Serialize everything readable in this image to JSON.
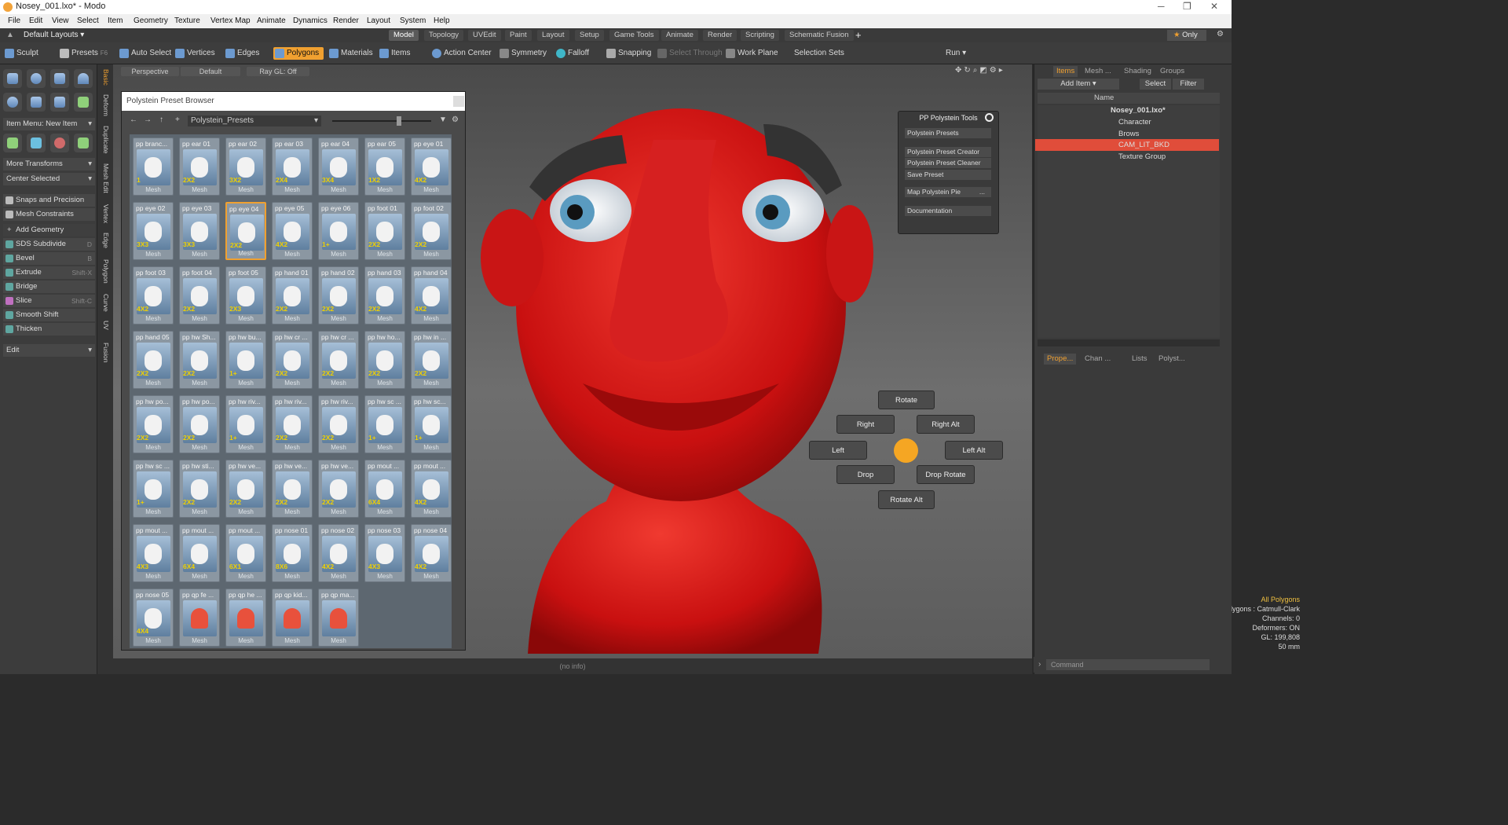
{
  "window": {
    "title": "Nosey_001.lxo* - Modo"
  },
  "menu": [
    "File",
    "Edit",
    "View",
    "Select",
    "Item",
    "Geometry",
    "Texture",
    "Vertex Map",
    "Animate",
    "Dynamics",
    "Render",
    "Layout",
    "System",
    "Help"
  ],
  "layout": {
    "default": "Default Layouts",
    "tabs": [
      "Model",
      "Topology",
      "UVEdit",
      "Paint",
      "Layout",
      "Setup",
      "Game Tools",
      "Animate",
      "Render",
      "Scripting",
      "Schematic Fusion"
    ],
    "active": "Model",
    "only": "Only"
  },
  "toolbar": {
    "sculpt": "Sculpt",
    "presets": "Presets",
    "presets_key": "F6",
    "auto_select": "Auto Select",
    "vertices": "Vertices",
    "edges": "Edges",
    "polygons": "Polygons",
    "materials": "Materials",
    "items": "Items",
    "action_center": "Action Center",
    "symmetry": "Symmetry",
    "falloff": "Falloff",
    "snapping": "Snapping",
    "select_through": "Select Through",
    "work_plane": "Work Plane",
    "selection_sets": "Selection Sets",
    "run": "Run"
  },
  "left": {
    "item_menu": "Item Menu: New Item",
    "more_transforms": "More Transforms",
    "center_selected": "Center Selected",
    "snaps": "Snaps and Precision",
    "constraints": "Mesh Constraints",
    "add_geometry": "Add Geometry",
    "tools": [
      {
        "label": "SDS Subdivide",
        "key": "D"
      },
      {
        "label": "Bevel",
        "key": "B"
      },
      {
        "label": "Extrude",
        "key": "Shift-X"
      },
      {
        "label": "Bridge",
        "key": ""
      },
      {
        "label": "Slice",
        "key": "Shift-C"
      },
      {
        "label": "Smooth Shift",
        "key": ""
      },
      {
        "label": "Thicken",
        "key": ""
      }
    ],
    "edit": "Edit"
  },
  "vtabs": [
    "Basic",
    "Deform",
    "Duplicate",
    "Mesh Edit",
    "Vertex",
    "Edge",
    "Polygon",
    "Curve",
    "UV",
    "Fusion"
  ],
  "viewport": {
    "perspective": "Perspective",
    "default": "Default",
    "raygl": "Ray GL: Off",
    "no_info": "(no info)"
  },
  "browser": {
    "title": "Polystein Preset Browser",
    "folder": "Polystein_Presets",
    "items": [
      {
        "n": "pp branc...",
        "b": "1",
        "m": "Mesh"
      },
      {
        "n": "pp ear 01",
        "b": "2X2",
        "m": "Mesh"
      },
      {
        "n": "pp ear 02",
        "b": "3X2",
        "m": "Mesh"
      },
      {
        "n": "pp ear 03",
        "b": "2X4",
        "m": "Mesh"
      },
      {
        "n": "pp ear 04",
        "b": "3X4",
        "m": "Mesh"
      },
      {
        "n": "pp ear 05",
        "b": "1X2",
        "m": "Mesh"
      },
      {
        "n": "pp eye 01",
        "b": "4X2",
        "m": "Mesh"
      },
      {
        "n": "pp eye 02",
        "b": "3X3",
        "m": "Mesh"
      },
      {
        "n": "pp eye 03",
        "b": "3X3",
        "m": "Mesh"
      },
      {
        "n": "pp eye 04",
        "b": "2X2",
        "m": "Mesh"
      },
      {
        "n": "pp eye 05",
        "b": "4X2",
        "m": "Mesh"
      },
      {
        "n": "pp eye 06",
        "b": "1+",
        "m": "Mesh"
      },
      {
        "n": "pp foot 01",
        "b": "2X2",
        "m": "Mesh"
      },
      {
        "n": "pp foot 02",
        "b": "2X2",
        "m": "Mesh"
      },
      {
        "n": "pp foot 03",
        "b": "4X2",
        "m": "Mesh"
      },
      {
        "n": "pp foot 04",
        "b": "2X2",
        "m": "Mesh"
      },
      {
        "n": "pp foot 05",
        "b": "2X3",
        "m": "Mesh"
      },
      {
        "n": "pp hand 01",
        "b": "2X2",
        "m": "Mesh"
      },
      {
        "n": "pp hand 02",
        "b": "2X2",
        "m": "Mesh"
      },
      {
        "n": "pp hand 03",
        "b": "2X2",
        "m": "Mesh"
      },
      {
        "n": "pp hand 04",
        "b": "4X2",
        "m": "Mesh"
      },
      {
        "n": "pp hand 05",
        "b": "2X2",
        "m": "Mesh"
      },
      {
        "n": "pp hw Sh...",
        "b": "2X2",
        "m": "Mesh"
      },
      {
        "n": "pp hw bu...",
        "b": "1+",
        "m": "Mesh"
      },
      {
        "n": "pp hw cr ...",
        "b": "2X2",
        "m": "Mesh"
      },
      {
        "n": "pp hw cr ...",
        "b": "2X2",
        "m": "Mesh"
      },
      {
        "n": "pp hw ho...",
        "b": "2X2",
        "m": "Mesh"
      },
      {
        "n": "pp hw in ...",
        "b": "2X2",
        "m": "Mesh"
      },
      {
        "n": "pp hw po...",
        "b": "2X2",
        "m": "Mesh"
      },
      {
        "n": "pp hw po...",
        "b": "2X2",
        "m": "Mesh"
      },
      {
        "n": "pp hw riv...",
        "b": "1+",
        "m": "Mesh"
      },
      {
        "n": "pp hw riv...",
        "b": "2X2",
        "m": "Mesh"
      },
      {
        "n": "pp hw riv...",
        "b": "2X2",
        "m": "Mesh"
      },
      {
        "n": "pp hw sc ...",
        "b": "1+",
        "m": "Mesh"
      },
      {
        "n": "pp hw sc...",
        "b": "1+",
        "m": "Mesh"
      },
      {
        "n": "pp hw sc ...",
        "b": "1+",
        "m": "Mesh"
      },
      {
        "n": "pp hw sti...",
        "b": "2X2",
        "m": "Mesh"
      },
      {
        "n": "pp hw ve...",
        "b": "2X2",
        "m": "Mesh"
      },
      {
        "n": "pp hw ve...",
        "b": "2X2",
        "m": "Mesh"
      },
      {
        "n": "pp hw ve...",
        "b": "2X2",
        "m": "Mesh"
      },
      {
        "n": "pp mout ...",
        "b": "6X4",
        "m": "Mesh"
      },
      {
        "n": "pp mout ...",
        "b": "4X2",
        "m": "Mesh"
      },
      {
        "n": "pp mout ...",
        "b": "4X3",
        "m": "Mesh"
      },
      {
        "n": "pp mout ...",
        "b": "6X4",
        "m": "Mesh"
      },
      {
        "n": "pp mout ...",
        "b": "6X1",
        "m": "Mesh"
      },
      {
        "n": "pp nose 01",
        "b": "8X6",
        "m": "Mesh"
      },
      {
        "n": "pp nose 02",
        "b": "4X2",
        "m": "Mesh"
      },
      {
        "n": "pp nose 03",
        "b": "4X3",
        "m": "Mesh"
      },
      {
        "n": "pp nose 04",
        "b": "4X2",
        "m": "Mesh"
      },
      {
        "n": "pp nose 05",
        "b": "4X4",
        "m": "Mesh"
      },
      {
        "n": "pp qp fe ...",
        "b": "",
        "m": "Mesh"
      },
      {
        "n": "pp qp he ...",
        "b": "",
        "m": "Mesh"
      },
      {
        "n": "pp qp kid...",
        "b": "",
        "m": "Mesh"
      },
      {
        "n": "pp qp ma...",
        "b": "",
        "m": "Mesh"
      }
    ]
  },
  "pp_tools": {
    "title": "PP Polystein Tools",
    "buttons": [
      "Polystein Presets",
      "Polystein Preset Creator",
      "Polystein Preset Cleaner",
      "Save Preset",
      "Map Polystein Pie",
      "Documentation"
    ],
    "dots": "..."
  },
  "pie": {
    "rotate": "Rotate",
    "right": "Right",
    "right_alt": "Right Alt",
    "left": "Left",
    "left_alt": "Left Alt",
    "drop": "Drop",
    "drop_rotate": "Drop Rotate",
    "rotate_alt": "Rotate Alt"
  },
  "hud": {
    "line1": "All Polygons",
    "line2": "Polygons : Catmull-Clark",
    "line3": "Channels: 0",
    "line4": "Deformers: ON",
    "line5": "GL: 199,808",
    "line6": "50 mm"
  },
  "right": {
    "tabs": [
      "Items",
      "Mesh ...",
      "Shading",
      "Groups"
    ],
    "add_item": "Add Item",
    "select": "Select",
    "filter": "Filter",
    "name_col": "Name",
    "tree": [
      "Nosey_001.lxo*",
      "Character",
      "Brows",
      "CAM_LIT_BKD",
      "Texture Group"
    ],
    "props_tabs": [
      "Prope...",
      "Chan ...",
      "Lists",
      "Polyst..."
    ],
    "command": "Command"
  },
  "colors": {
    "accent": "#f0a030",
    "selected_item": "#e04d3a",
    "head": "#d01515"
  }
}
